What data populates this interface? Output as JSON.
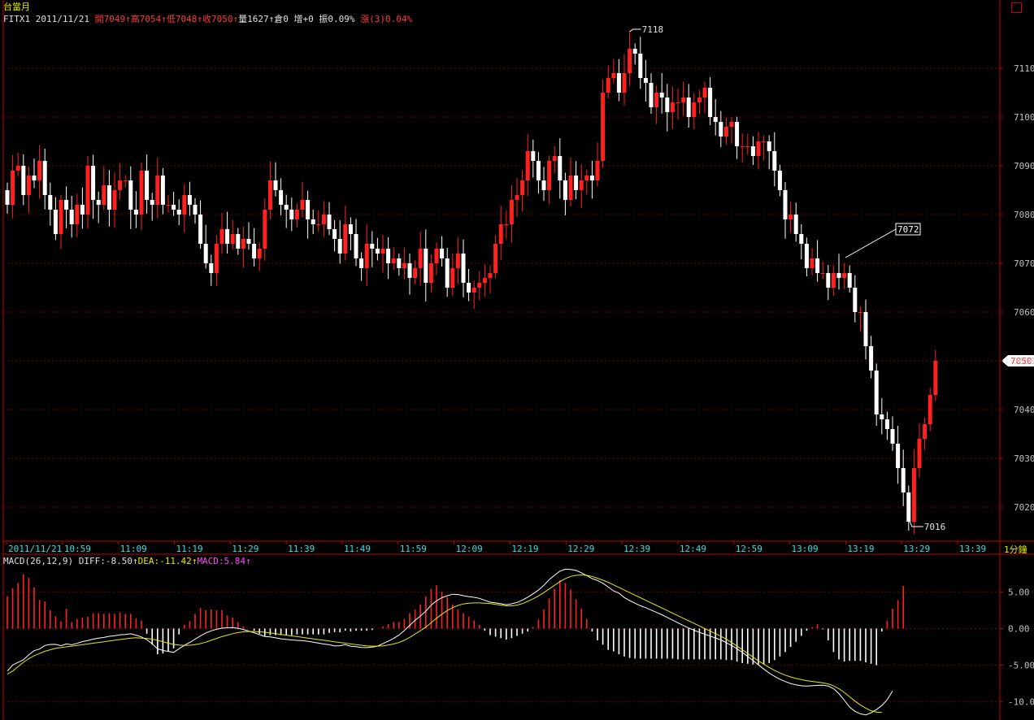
{
  "title": "台當月",
  "info": {
    "symbol": "FITX1",
    "date": "2011/11/21",
    "open": "開7049",
    "high": "高7054",
    "low": "低7048",
    "close": "收7050",
    "volume": "量1627",
    "position": "倉0",
    "change_oi": "增+0",
    "amplitude": "振0.09%",
    "rise": "漲(3)0.04%"
  },
  "macd_info": {
    "name": "MACD(26,12,9)",
    "diff": "DIFF:-8.50",
    "dea": "DEA:-11.42",
    "macd": "MACD:5.84"
  },
  "period_label": "1分鐘",
  "arrow": "↑",
  "colors": {
    "up": "#ff2020",
    "down": "#ffffff",
    "grid": "#7a0000",
    "axis": "#c00000",
    "dea": "#e8e800"
  },
  "chart_data": [
    {
      "type": "candlestick",
      "title": "",
      "ylim": [
        7013,
        7123
      ],
      "yticks": [
        7020,
        7030,
        7040,
        7050,
        7060,
        7070,
        7080,
        7090,
        7100,
        7110
      ],
      "xtick_labels": [
        "2011/11/21",
        "10:59",
        "11:09",
        "11:19",
        "11:29",
        "11:39",
        "11:49",
        "11:59",
        "12:09",
        "12:19",
        "12:29",
        "12:39",
        "12:49",
        "12:59",
        "13:09",
        "13:19",
        "13:29",
        "13:39"
      ],
      "last_price": 7050,
      "high_mark": {
        "value": 7118,
        "label": "7118"
      },
      "low_mark": {
        "value": 7016,
        "label": "7016"
      },
      "annotation": {
        "value": 7072,
        "label": "7072"
      },
      "close": [
        7082,
        7089,
        7090,
        7084,
        7088,
        7087,
        7091,
        7084,
        7081,
        7076,
        7083,
        7081,
        7078,
        7082,
        7080,
        7090,
        7083,
        7082,
        7086,
        7081,
        7085,
        7087,
        7087,
        7081,
        7080,
        7089,
        7083,
        7082,
        7088,
        7082,
        7082,
        7081,
        7080,
        7084,
        7082,
        7080,
        7074,
        7070,
        7068,
        7074,
        7077,
        7074,
        7076,
        7073,
        7075,
        7074,
        7071,
        7073,
        7081,
        7087,
        7085,
        7082,
        7081,
        7079,
        7081,
        7083,
        7079,
        7078,
        7078,
        7080,
        7077,
        7075,
        7072,
        7078,
        7076,
        7071,
        7069,
        7074,
        7073,
        7072,
        7073,
        7070,
        7071,
        7069,
        7070,
        7067,
        7069,
        7073,
        7066,
        7070,
        7073,
        7071,
        7065,
        7069,
        7072,
        7066,
        7064,
        7065,
        7066,
        7067,
        7068,
        7074,
        7078,
        7078,
        7083,
        7084,
        7087,
        7093,
        7091,
        7087,
        7085,
        7091,
        7092,
        7087,
        7083,
        7088,
        7085,
        7087,
        7088,
        7087,
        7091,
        7105,
        7108,
        7109,
        7105,
        7109,
        7114,
        7113,
        7108,
        7107,
        7102,
        7105,
        7104,
        7101,
        7103,
        7103,
        7104,
        7100,
        7103,
        7104,
        7106,
        7100,
        7099,
        7096,
        7098,
        7099,
        7094,
        7094,
        7094,
        7092,
        7095,
        7095,
        7093,
        7089,
        7085,
        7079,
        7080,
        7076,
        7074,
        7069,
        7071,
        7068,
        7068,
        7065,
        7068,
        7067,
        7068,
        7065,
        7060,
        7060,
        7053,
        7048,
        7039,
        7038,
        7036,
        7033,
        7028,
        7023,
        7017,
        7028,
        7034,
        7037,
        7043,
        7050
      ]
    },
    {
      "type": "macd",
      "ylim": [
        -11.8,
        8.8
      ],
      "yticks": [
        5.0,
        0.0,
        -5.0,
        -10.0
      ],
      "ytick_labels": [
        "5.00",
        "0.00",
        "-5.00",
        "-10.00"
      ],
      "series": [
        {
          "name": "DIFF",
          "values": [
            -5.8,
            -4.98,
            -4.61,
            -4.26,
            -3.59,
            -3.02,
            -2.8,
            -2.31,
            -2.17,
            -2.15,
            -2.34,
            -2.1,
            -2.21,
            -2.02,
            -1.78,
            -1.63,
            -1.45,
            -1.31,
            -1.21,
            -1.06,
            -0.99,
            -0.85,
            -0.8,
            -0.71,
            -0.9,
            -1.15,
            -1.52,
            -2.08,
            -2.76,
            -2.98,
            -3.12,
            -3.25,
            -2.75,
            -2.29,
            -1.9,
            -1.45,
            -1.01,
            -0.6,
            -0.32,
            -0.11,
            0.05,
            0.11,
            0.13,
            0.02,
            -0.13,
            -0.35,
            -0.57,
            -0.82,
            -1.08,
            -1.13,
            -1.27,
            -1.4,
            -1.47,
            -1.56,
            -1.61,
            -1.65,
            -1.73,
            -1.87,
            -1.99,
            -2.11,
            -2.21,
            -2.37,
            -2.34,
            -2.2,
            -2.41,
            -2.48,
            -2.58,
            -2.6,
            -2.53,
            -2.4,
            -2.07,
            -1.73,
            -1.35,
            -0.9,
            -0.27,
            0.43,
            1.12,
            1.71,
            2.36,
            3.2,
            3.78,
            4.2,
            4.47,
            4.68,
            4.64,
            4.48,
            4.34,
            4.26,
            4.12,
            3.85,
            3.6,
            3.49,
            3.38,
            3.25,
            3.37,
            3.55,
            3.88,
            4.27,
            4.73,
            5.25,
            5.89,
            6.66,
            7.26,
            7.82,
            8.09,
            8.06,
            7.92,
            7.6,
            7.23,
            6.81,
            6.55,
            6.18,
            5.65,
            5.13,
            4.82,
            4.23,
            3.82,
            3.45,
            3.11,
            2.84,
            2.52,
            2.2,
            1.88,
            1.52,
            1.15,
            0.79,
            0.42,
            0.07,
            -0.23,
            -0.52,
            -0.77,
            -1.02,
            -1.29,
            -1.55,
            -1.92,
            -2.31,
            -2.75,
            -3.25,
            -3.79,
            -4.37,
            -4.95,
            -5.52,
            -6.06,
            -6.52,
            -6.91,
            -7.23,
            -7.49,
            -7.68,
            -7.8,
            -7.83,
            -7.8,
            -7.75,
            -7.71,
            -7.83,
            -8.19,
            -8.86,
            -9.75,
            -10.72,
            -11.28,
            -11.62,
            -11.77,
            -11.49,
            -11.05,
            -10.49,
            -9.7,
            -8.5
          ]
        },
        {
          "name": "DEA",
          "values": [
            -6.2,
            -5.8,
            -5.2,
            -4.6,
            -4.1,
            -3.7,
            -3.4,
            -3.1,
            -2.9,
            -2.7,
            -2.6,
            -2.5,
            -2.4,
            -2.3,
            -2.2,
            -2.1,
            -2.0,
            -1.9,
            -1.8,
            -1.7,
            -1.6,
            -1.5,
            -1.4,
            -1.3,
            -1.25,
            -1.3,
            -1.35,
            -1.45,
            -1.6,
            -1.8,
            -2.0,
            -2.15,
            -2.25,
            -2.3,
            -2.28,
            -2.2,
            -2.05,
            -1.85,
            -1.6,
            -1.35,
            -1.1,
            -0.9,
            -0.7,
            -0.55,
            -0.45,
            -0.4,
            -0.4,
            -0.45,
            -0.5,
            -0.6,
            -0.7,
            -0.8,
            -0.9,
            -1.0,
            -1.1,
            -1.2,
            -1.3,
            -1.4,
            -1.5,
            -1.6,
            -1.7,
            -1.8,
            -1.9,
            -2.0,
            -2.1,
            -2.2,
            -2.28,
            -2.35,
            -2.4,
            -2.4,
            -2.35,
            -2.25,
            -2.1,
            -1.9,
            -1.6,
            -1.2,
            -0.75,
            -0.3,
            0.2,
            0.8,
            1.4,
            1.95,
            2.45,
            2.85,
            3.15,
            3.35,
            3.45,
            3.5,
            3.5,
            3.45,
            3.4,
            3.3,
            3.2,
            3.1,
            3.1,
            3.2,
            3.4,
            3.7,
            4.05,
            4.45,
            4.9,
            5.4,
            5.9,
            6.4,
            6.8,
            7.1,
            7.25,
            7.3,
            7.25,
            7.1,
            6.85,
            6.6,
            6.3,
            5.95,
            5.6,
            5.25,
            4.9,
            4.55,
            4.2,
            3.85,
            3.5,
            3.15,
            2.8,
            2.45,
            2.1,
            1.75,
            1.4,
            1.05,
            0.7,
            0.35,
            0.0,
            -0.35,
            -0.7,
            -1.05,
            -1.45,
            -1.9,
            -2.4,
            -2.9,
            -3.4,
            -3.9,
            -4.4,
            -4.85,
            -5.3,
            -5.7,
            -6.05,
            -6.35,
            -6.6,
            -6.8,
            -6.95,
            -7.1,
            -7.2,
            -7.3,
            -7.4,
            -7.55,
            -7.8,
            -8.2,
            -8.7,
            -9.3,
            -9.9,
            -10.4,
            -10.85,
            -11.2,
            -11.4,
            -11.42
          ]
        }
      ],
      "histogram": [
        4.4,
        5.5,
        6.2,
        7.4,
        6.9,
        5.6,
        3.9,
        3.7,
        2.5,
        1.7,
        1.0,
        2.7,
        0.9,
        1.3,
        1.5,
        1.6,
        2.1,
        2.1,
        2.0,
        2.1,
        2.0,
        2.2,
        2.0,
        2.0,
        1.4,
        1.1,
        -0.7,
        -2.2,
        -3.5,
        -3.4,
        -3.1,
        -2.7,
        -0.8,
        0.5,
        1.0,
        2.0,
        2.8,
        2.5,
        2.6,
        2.5,
        2.5,
        1.8,
        1.5,
        0.9,
        0.3,
        0.0,
        -0.3,
        -0.7,
        -1.0,
        -0.9,
        -0.9,
        -0.9,
        -0.9,
        -0.9,
        -0.8,
        -0.8,
        -0.8,
        -0.8,
        -0.8,
        -0.8,
        -0.6,
        -0.5,
        -0.5,
        -0.3,
        -0.4,
        -0.3,
        -0.3,
        -0.3,
        -0.2,
        0.0,
        0.3,
        0.6,
        0.9,
        0.9,
        1.3,
        2.1,
        2.6,
        3.3,
        4.4,
        5.4,
        5.9,
        5.0,
        4.3,
        3.3,
        2.6,
        2.1,
        1.6,
        1.1,
        0.5,
        -0.3,
        -0.9,
        -1.1,
        -1.3,
        -1.5,
        -1.3,
        -1.0,
        -0.7,
        -0.4,
        0.2,
        1.2,
        2.6,
        4.1,
        5.4,
        6.6,
        6.2,
        5.3,
        4.0,
        2.7,
        1.3,
        -0.4,
        -1.6,
        -2.2,
        -2.9,
        -3.1,
        -3.5,
        -3.8,
        -4.0,
        -4.1,
        -4.1,
        -4.1,
        -4.1,
        -4.1,
        -4.1,
        -4.1,
        -4.1,
        -4.2,
        -4.2,
        -4.2,
        -4.2,
        -4.2,
        -4.2,
        -4.2,
        -4.2,
        -4.2,
        -4.3,
        -4.3,
        -4.5,
        -4.7,
        -4.8,
        -4.9,
        -4.9,
        -4.9,
        -4.7,
        -4.3,
        -3.8,
        -3.2,
        -2.5,
        -1.8,
        -1.0,
        -0.3,
        0.2,
        0.6,
        -0.1,
        -1.6,
        -3.2,
        -4.2,
        -4.5,
        -4.4,
        -4.4,
        -4.4,
        -4.6,
        -4.8,
        -5.0,
        -0.4,
        1.1,
        2.7,
        3.9,
        5.8
      ]
    }
  ]
}
